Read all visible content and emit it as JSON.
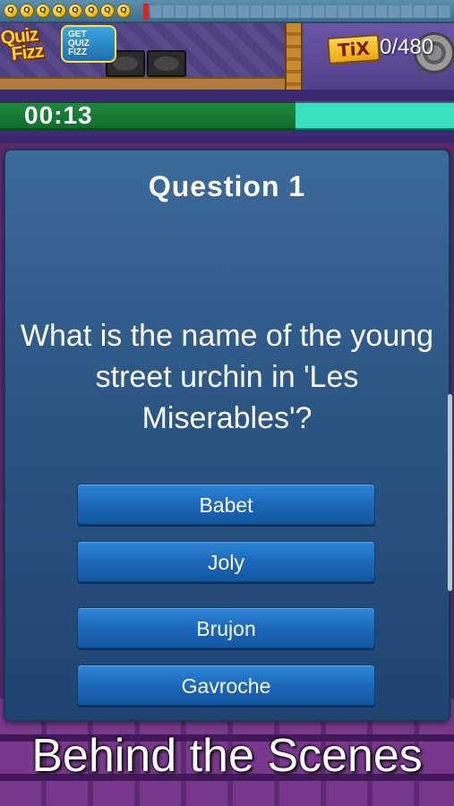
{
  "progress": {
    "badges": [
      "Q",
      "Q",
      "Q",
      "Q",
      "Q",
      "Q",
      "Q",
      "Q"
    ]
  },
  "header": {
    "logo_line1": "Quiz",
    "logo_line2": "Fizz",
    "get_badge_lines": [
      "GET",
      "QUIZ",
      "FIZZ"
    ],
    "tix_label": "TiX",
    "tix_count": "0/480"
  },
  "timer": {
    "text": "00:13",
    "remaining_fraction": 0.65
  },
  "question": {
    "title": "Question 1",
    "text": "What is the name of the young street urchin in 'Les Miserables'?",
    "answers": [
      "Babet",
      "Joly",
      "Brujon",
      "Gavroche"
    ]
  },
  "caption": "Behind the Scenes",
  "colors": {
    "timer_fill": "#1e8a3e",
    "timer_track": "#38e0c0",
    "answer_button": "#1a66b8",
    "panel": "#2b5684"
  }
}
